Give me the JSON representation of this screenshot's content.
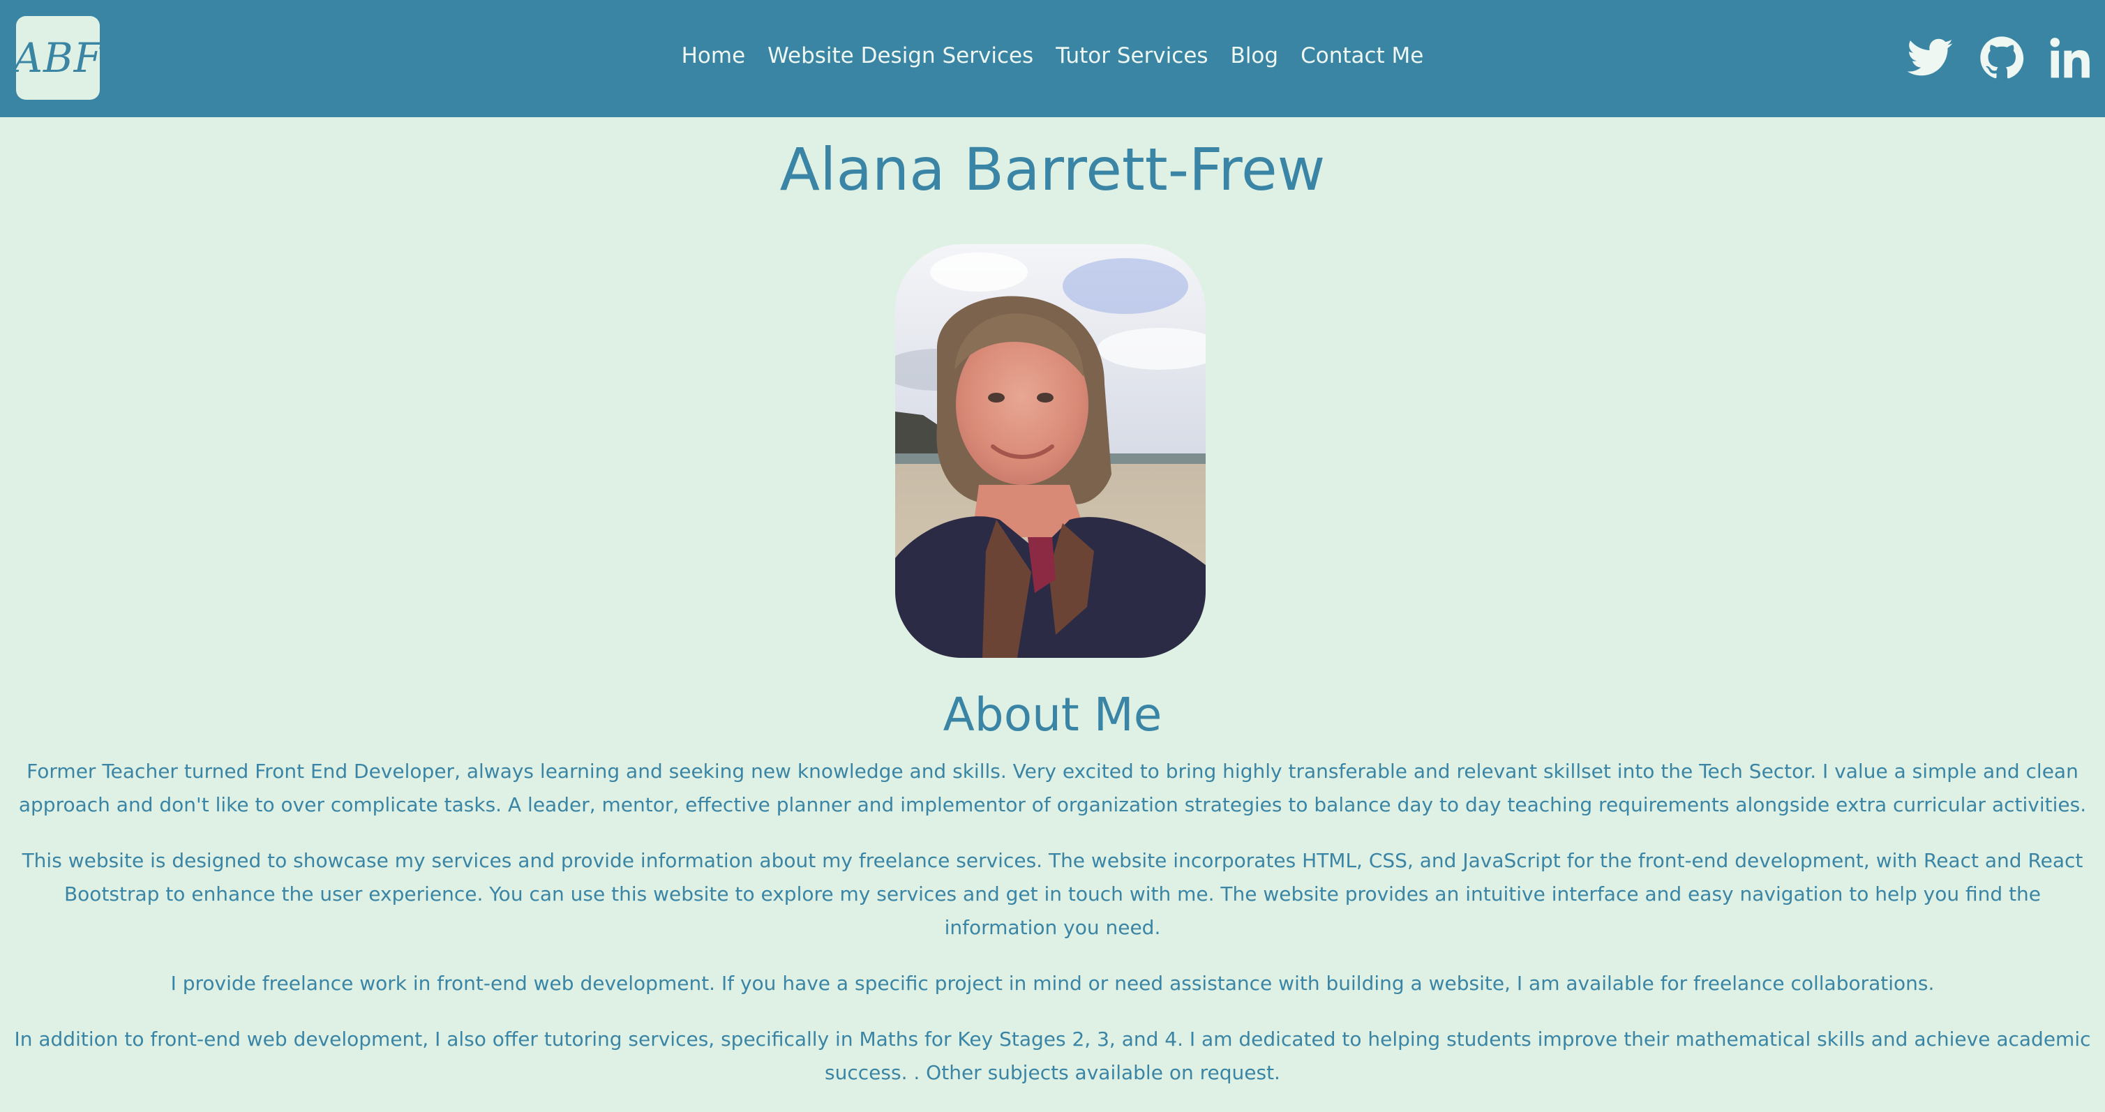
{
  "nav": {
    "logo_text": "ABF",
    "links": [
      "Home",
      "Website Design Services",
      "Tutor Services",
      "Blog",
      "Contact Me"
    ],
    "social_icons": [
      "twitter-icon",
      "github-icon",
      "linkedin-icon"
    ]
  },
  "main": {
    "name": "Alana Barrett-Frew",
    "about_title": "About Me",
    "paragraphs": [
      "Former Teacher turned Front End Developer, always learning and seeking new knowledge and skills. Very excited to bring highly transferable and relevant skillset into the Tech Sector. I value a simple and clean approach and don't like to over complicate tasks. A leader, mentor, effective planner and implementor of organization strategies to balance day to day teaching requirements alongside extra curricular activities.",
      "This website is designed to showcase my services and provide information about my freelance services. The website incorporates HTML, CSS, and JavaScript for the front-end development, with React and React Bootstrap to enhance the user experience. You can use this website to explore my services and get in touch with me. The website provides an intuitive interface and easy navigation to help you find the information you need.",
      "I provide freelance work in front-end web development. If you have a specific project in mind or need assistance with building a website, I am available for freelance collaborations.",
      "In addition to front-end web development, I also offer tutoring services, specifically in Maths for Key Stages 2, 3, and 4. I am dedicated to helping students improve their mathematical skills and achieve academic success. . Other subjects available on request."
    ]
  },
  "colors": {
    "navbar": "#3b85a4",
    "background": "#dff1e4",
    "text": "#3a85a5",
    "nav_text": "#eef7f1"
  }
}
